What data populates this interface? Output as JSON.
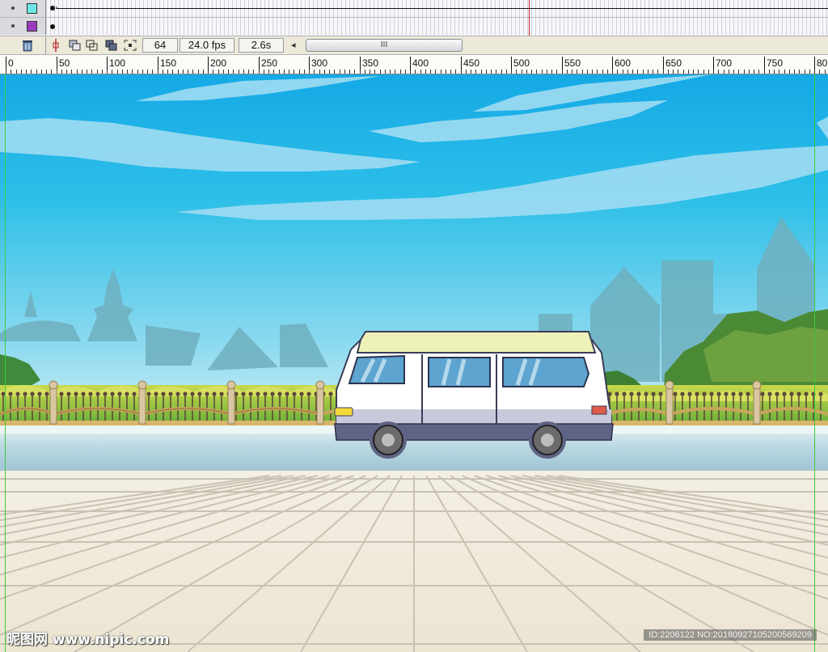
{
  "timeline": {
    "layers": [
      {
        "swatch_color": "#6ee6e6",
        "has_tween": true
      },
      {
        "swatch_color": "#9b3cc0",
        "has_tween": false
      }
    ]
  },
  "controls": {
    "current_frame": "64",
    "frame_rate": "24.0 fps",
    "elapsed_time": "2.6s",
    "scroll_grip": "III",
    "scroll_left_arrow": "◂"
  },
  "ruler": {
    "labels": [
      "0",
      "50",
      "100",
      "150",
      "200",
      "250",
      "300",
      "350",
      "400",
      "450",
      "500",
      "550",
      "600",
      "650",
      "700",
      "750",
      "80"
    ]
  },
  "colors": {
    "sky_top": "#17aee8",
    "sky_bottom": "#bfe9f4",
    "van_body": "#ffffff",
    "van_roof": "#eef2b8",
    "van_skirt": "#5f6385",
    "fence_rail": "#c9a55e",
    "pavement": "#efeadb"
  },
  "icons": [
    "trash-icon",
    "onion-skin-marker-icon",
    "onion-skin-icon",
    "onion-skin-outline-icon",
    "edit-multiple-frames-icon",
    "modify-markers-icon"
  ],
  "watermark": {
    "left": "昵图网 www.nipic.com",
    "right": "ID:2206122 NO:20180927105200569209"
  }
}
